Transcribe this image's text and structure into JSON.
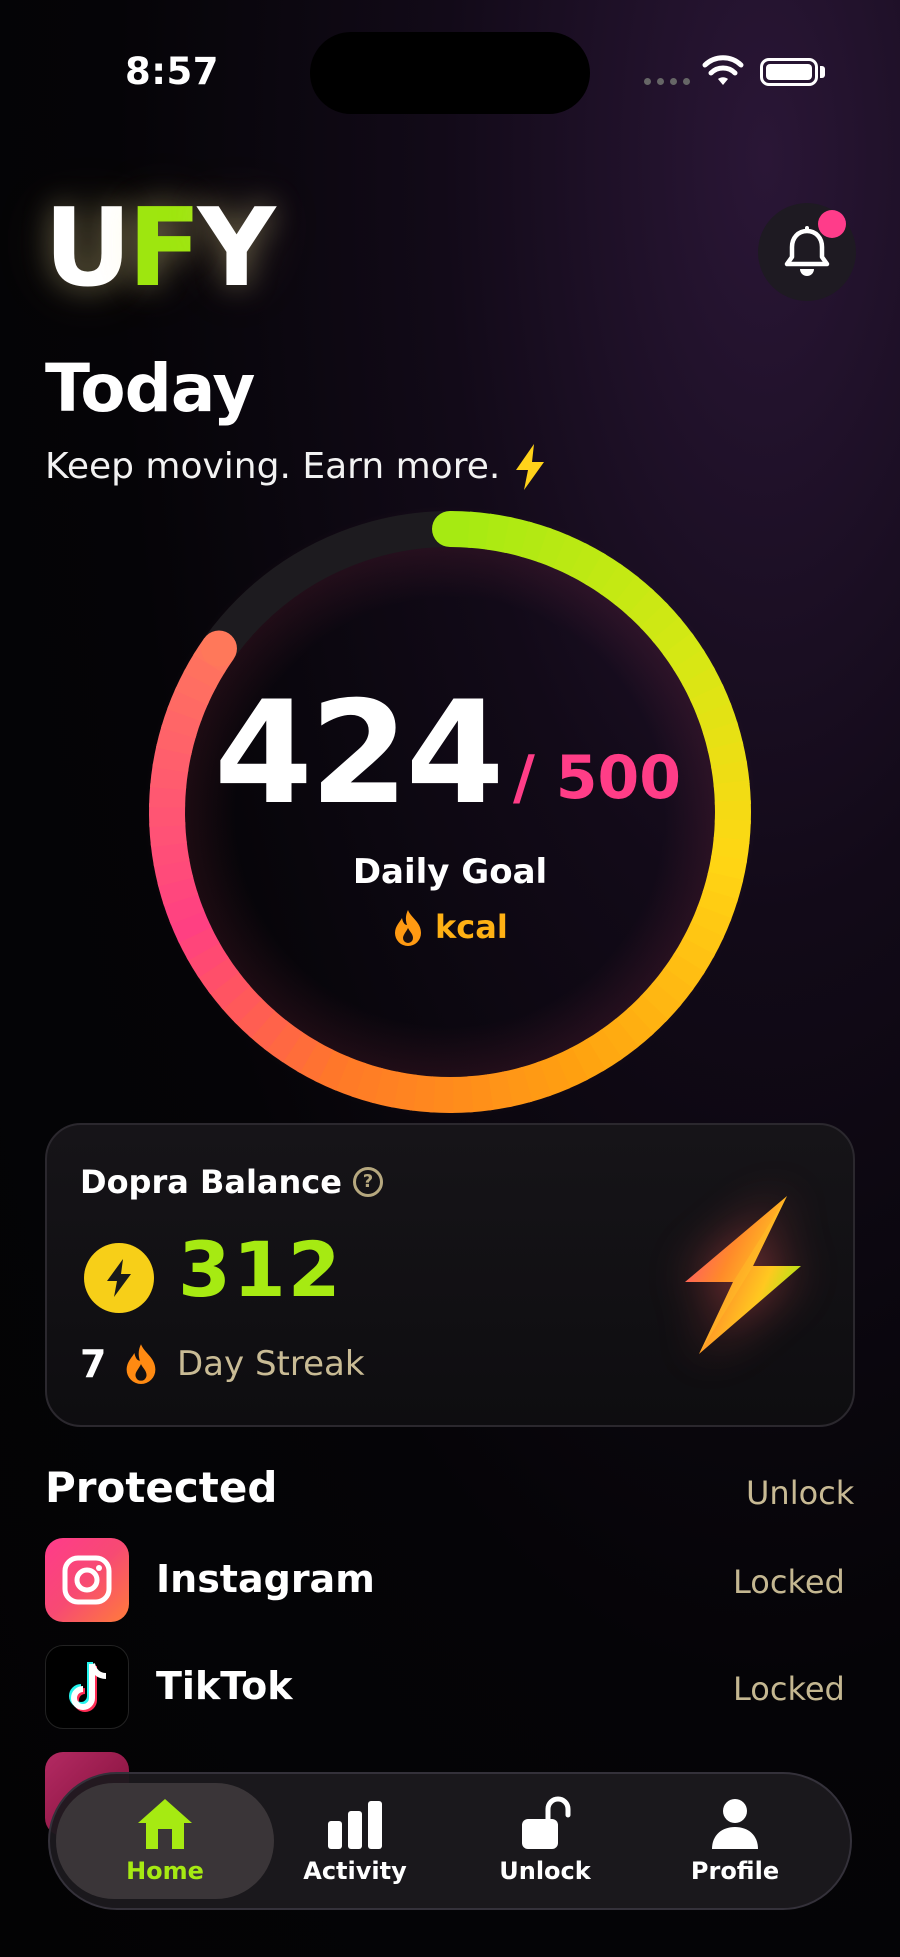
{
  "status_bar": {
    "time": "8:57"
  },
  "header": {
    "logo": {
      "u": "U",
      "f": "F",
      "y": "Y"
    },
    "title": "Today",
    "subtitle": "Keep moving. Earn more."
  },
  "goal_ring": {
    "current": "424",
    "goal": "/ 500",
    "label": "Daily Goal",
    "unit": "kcal",
    "progress_fraction": 0.848
  },
  "balance_card": {
    "title": "Dopra Balance",
    "help": "?",
    "balance": "312",
    "streak_count": "7",
    "streak_label": "Day Streak"
  },
  "protected": {
    "title": "Protected",
    "action": "Unlock",
    "apps": [
      {
        "name": "Instagram",
        "status": "Locked"
      },
      {
        "name": "TikTok",
        "status": "Locked"
      }
    ]
  },
  "tabs": [
    {
      "label": "Home",
      "active": true
    },
    {
      "label": "Activity",
      "active": false
    },
    {
      "label": "Unlock",
      "active": false
    },
    {
      "label": "Profile",
      "active": false
    }
  ],
  "colors": {
    "accent_green": "#a6ea12",
    "accent_pink": "#ff3d87",
    "accent_yellow": "#f7cf18",
    "accent_orange": "#ffb114"
  }
}
